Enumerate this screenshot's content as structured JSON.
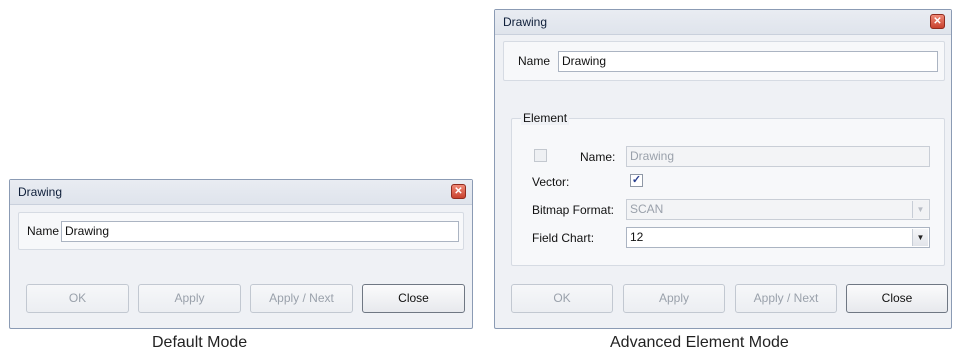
{
  "default_dialog": {
    "title": "Drawing",
    "name_label": "Name",
    "name_value": "Drawing",
    "buttons": {
      "ok": "OK",
      "apply": "Apply",
      "apply_next": "Apply / Next",
      "close": "Close"
    }
  },
  "advanced_dialog": {
    "title": "Drawing",
    "name_label": "Name",
    "name_value": "Drawing",
    "element_group_label": "Element",
    "element_name_label": "Name:",
    "element_name_value": "Drawing",
    "vector_label": "Vector:",
    "vector_checked": true,
    "bitmap_format_label": "Bitmap Format:",
    "bitmap_format_value": "SCAN",
    "field_chart_label": "Field Chart:",
    "field_chart_value": "12",
    "buttons": {
      "ok": "OK",
      "apply": "Apply",
      "apply_next": "Apply / Next",
      "close": "Close"
    }
  },
  "captions": {
    "default": "Default Mode",
    "advanced": "Advanced Element Mode"
  }
}
